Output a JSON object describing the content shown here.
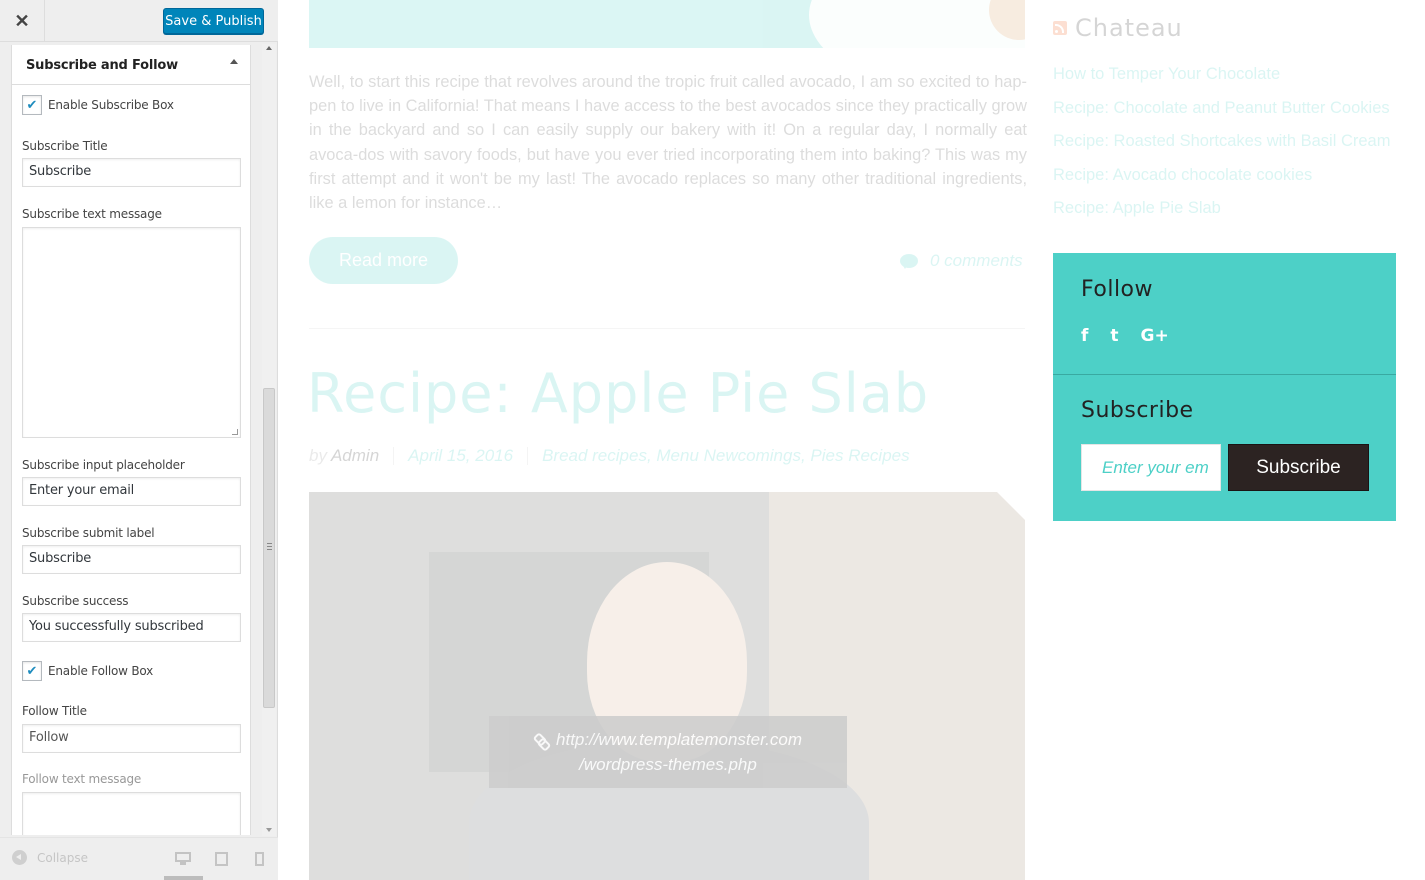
{
  "customizer": {
    "header": {
      "close_icon": "close-icon",
      "publish_label": "Save & Publish"
    },
    "section": {
      "title": "Subscribe and Follow"
    },
    "fields": {
      "enable_subscribe": {
        "label": "Enable Subscribe Box",
        "checked": true
      },
      "subscribe_title": {
        "label": "Subscribe Title",
        "value": "Subscribe"
      },
      "subscribe_text": {
        "label": "Subscribe text message",
        "value": ""
      },
      "subscribe_placeholder": {
        "label": "Subscribe input placeholder",
        "value": "Enter your email"
      },
      "subscribe_submit": {
        "label": "Subscribe submit label",
        "value": "Subscribe"
      },
      "subscribe_success": {
        "label": "Subscribe success",
        "value": "You successfully subscribed"
      },
      "enable_follow": {
        "label": "Enable Follow Box",
        "checked": true
      },
      "follow_title": {
        "label": "Follow Title",
        "value": "Follow"
      },
      "follow_text": {
        "label": "Follow text message",
        "value": ""
      }
    },
    "footer": {
      "collapse_label": "Collapse",
      "devices": [
        "desktop-icon",
        "tablet-icon",
        "mobile-icon"
      ]
    }
  },
  "preview": {
    "excerpt": "Well, to start this recipe that revolves around the tropic fruit called avocado, I am so excited to hap-pen to live in California! That means I have access to the best avocados since they practically grow in the backyard and so I can easily supply our bakery with it! On a regular day, I normally eat avoca-dos with savory foods, but have you ever tried incorporating them into baking? This was my first attempt and it won't be my last! The avocado replaces so many other traditional ingredients, like a lemon for instance…",
    "read_more": "Read more",
    "comments": "0 comments",
    "post": {
      "title": "Recipe: Apple Pie Slab",
      "by": "by",
      "author": "Admin",
      "date": "April 15, 2016",
      "categories": "Bread recipes, Menu Newcomings, Pies Recipes",
      "link_line1": "http://www.templatemonster.com",
      "link_line2": "/wordpress-themes.php"
    },
    "sidebar": {
      "rss_title": "Chateau",
      "rss_items": [
        "How to Temper Your Chocolate",
        "Recipe: Chocolate and Peanut Butter Cookies",
        "Recipe: Roasted Shortcakes with Basil Cream",
        "Recipe: Avocado chocolate cookies",
        "Recipe: Apple Pie Slab"
      ],
      "widget": {
        "follow_title": "Follow",
        "social": [
          "f",
          "t",
          "G+"
        ],
        "subscribe_title": "Subscribe",
        "email_placeholder": "Enter your em",
        "subscribe_button": "Subscribe",
        "accent_color": "#4dd0c7"
      }
    }
  }
}
